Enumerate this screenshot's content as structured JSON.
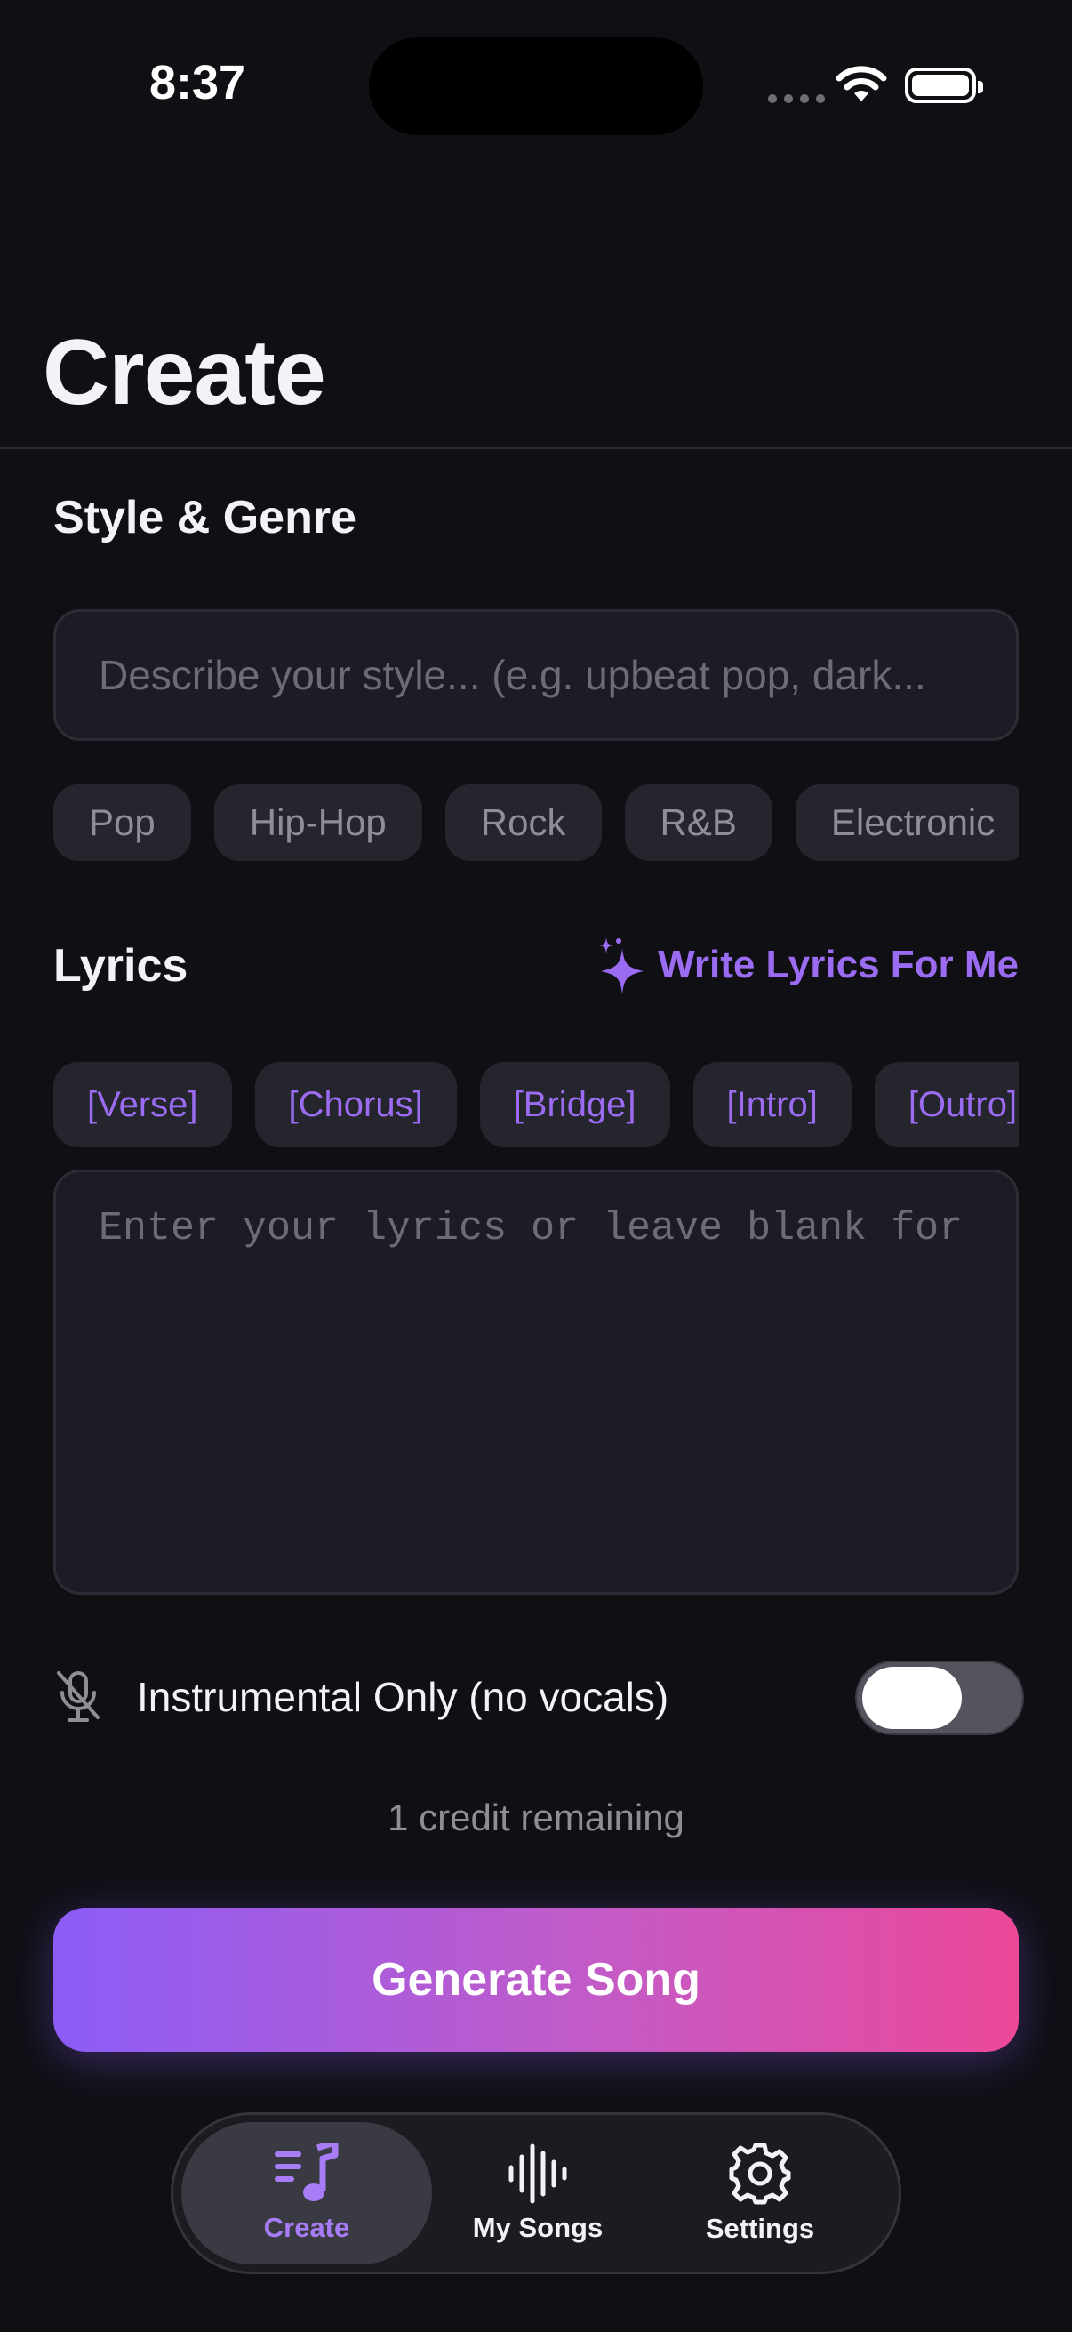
{
  "status_bar": {
    "time": "8:37"
  },
  "header": {
    "title": "Create"
  },
  "style_section": {
    "label": "Style & Genre",
    "input_placeholder": "Describe your style... (e.g. upbeat pop, dark...",
    "genres": [
      "Pop",
      "Hip-Hop",
      "Rock",
      "R&B",
      "Electronic"
    ]
  },
  "lyrics_section": {
    "label": "Lyrics",
    "write_button": "Write Lyrics For Me",
    "tags": [
      "[Verse]",
      "[Chorus]",
      "[Bridge]",
      "[Intro]",
      "[Outro]"
    ],
    "placeholder": "Enter your lyrics or leave blank for"
  },
  "instrumental": {
    "label": "Instrumental Only (no vocals)",
    "enabled": false
  },
  "credits_text": "1 credit remaining",
  "generate_button": "Generate Song",
  "tabbar": {
    "tabs": [
      {
        "label": "Create",
        "icon": "music-note-list-icon",
        "active": true
      },
      {
        "label": "My Songs",
        "icon": "waveform-icon",
        "active": false
      },
      {
        "label": "Settings",
        "icon": "gear-icon",
        "active": false
      }
    ]
  },
  "colors": {
    "accent": "#9b6bf2",
    "gradient_start": "#8b5cf6",
    "gradient_end": "#ec4899",
    "background": "#0f0f14"
  }
}
